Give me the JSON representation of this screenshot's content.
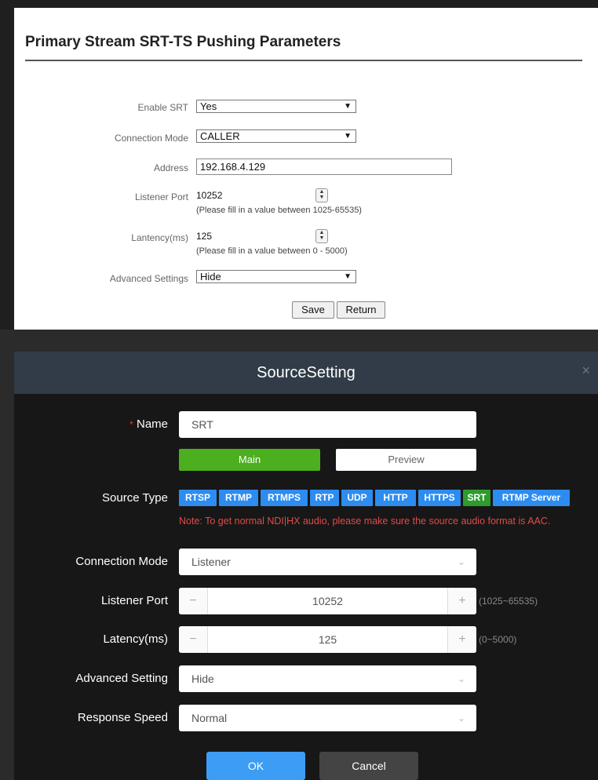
{
  "top": {
    "title": "Primary Stream SRT-TS Pushing Parameters",
    "enable_srt": {
      "label": "Enable SRT",
      "value": "Yes"
    },
    "connection_mode": {
      "label": "Connection Mode",
      "value": "CALLER"
    },
    "address": {
      "label": "Address",
      "value": "192.168.4.129"
    },
    "listener_port": {
      "label": "Listener Port",
      "value": "10252",
      "hint": "(Please fill in a value between 1025-65535)"
    },
    "latency": {
      "label": "Lantency(ms)",
      "value": "125",
      "hint": "(Please fill in a value between 0 - 5000)"
    },
    "advanced": {
      "label": "Advanced Settings",
      "value": "Hide"
    },
    "save_label": "Save",
    "return_label": "Return"
  },
  "dialog": {
    "title": "SourceSetting",
    "close_glyph": "×",
    "name": {
      "required_mark": "*",
      "label": "Name",
      "value": "SRT"
    },
    "tabs": [
      {
        "label": "Main",
        "active": true
      },
      {
        "label": "Preview",
        "active": false
      }
    ],
    "source_type": {
      "label": "Source Type",
      "options": [
        "RTSP",
        "RTMP",
        "RTMPS",
        "RTP",
        "UDP",
        "HTTP",
        "HTTPS",
        "SRT",
        "RTMP Server"
      ],
      "selected": "SRT"
    },
    "note": "Note: To get normal NDI|HX audio, please make sure the source audio format is AAC.",
    "connection_mode": {
      "label": "Connection Mode",
      "value": "Listener"
    },
    "listener_port": {
      "label": "Listener Port",
      "value": "10252",
      "range": "(1025~65535)"
    },
    "latency": {
      "label": "Latency(ms)",
      "value": "125",
      "range": "(0~5000)"
    },
    "advanced_setting": {
      "label": "Advanced Setting",
      "value": "Hide"
    },
    "response_speed": {
      "label": "Response Speed",
      "value": "Normal"
    },
    "ok_label": "OK",
    "cancel_label": "Cancel",
    "minus_glyph": "−",
    "plus_glyph": "+"
  },
  "colors": {
    "tag_blue": "#2d8cf0",
    "tag_green": "#2e9b2e",
    "tab_active": "#4caf1f",
    "ok_blue": "#3d9df5",
    "cancel_dark": "#444444",
    "note_red": "#e24a4a"
  },
  "icons": {
    "select_chevron": "chevron-down-icon",
    "spin": "spin-arrows-icon",
    "close": "close-icon"
  }
}
